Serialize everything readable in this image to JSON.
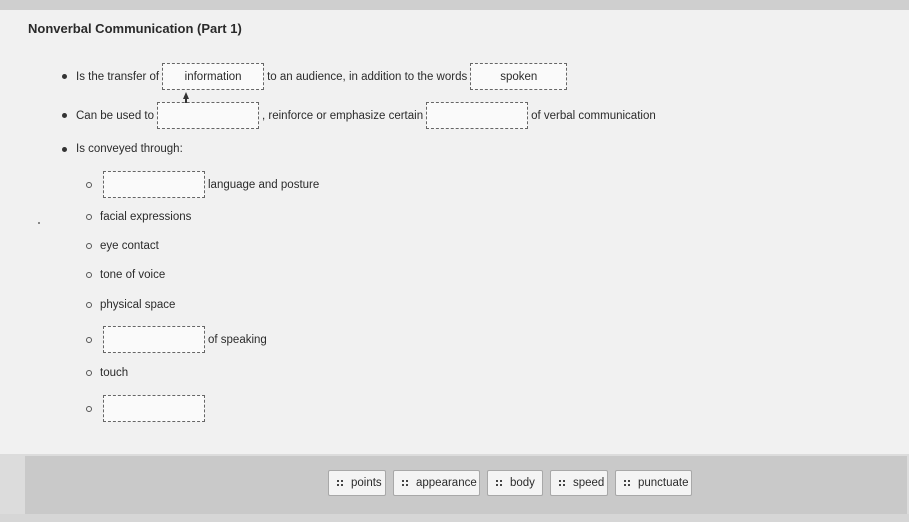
{
  "title": "Nonverbal Communication (Part 1)",
  "bullets": {
    "b1": {
      "before": "Is the transfer of",
      "blank1": "information",
      "middle": "to an audience, in addition to the words",
      "blank2": "spoken"
    },
    "b2": {
      "before": "Can be used to",
      "blank1": "",
      "middle": ", reinforce or emphasize certain",
      "blank2": "",
      "after": "of verbal communication"
    },
    "b3": {
      "text": "Is conveyed through:"
    }
  },
  "subitems": {
    "s1": {
      "blank": "",
      "after": "language and posture"
    },
    "s2": {
      "text": "facial expressions"
    },
    "s3": {
      "text": "eye contact"
    },
    "s4": {
      "text": "tone of voice"
    },
    "s5": {
      "text": "physical space"
    },
    "s6": {
      "blank": "",
      "after": "of speaking"
    },
    "s7": {
      "text": "touch"
    },
    "s8": {
      "blank": ""
    }
  },
  "word_bank": [
    "points",
    "appearance",
    "body",
    "speed",
    "punctuate"
  ]
}
